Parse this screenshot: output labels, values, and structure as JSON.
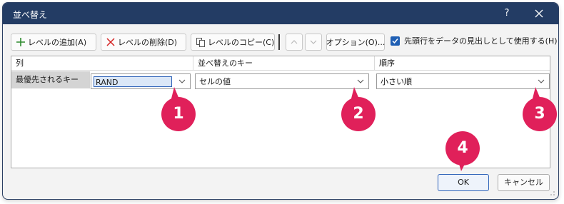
{
  "window": {
    "title": "並べ替え",
    "help_label": "?"
  },
  "toolbar": {
    "add_level": "レベルの追加(A)",
    "delete_level": "レベルの削除(D)",
    "copy_level": "レベルのコピー(C)",
    "options": "オプション(O)...",
    "header_checkbox_label": "先頭行をデータの見出しとして使用する(H)",
    "header_checkbox_checked": true
  },
  "grid": {
    "headers": [
      "列",
      "並べ替えのキー",
      "順序"
    ],
    "row": {
      "label": "最優先されるキー",
      "column": "RAND",
      "sort_on": "セルの値",
      "order": "小さい順"
    }
  },
  "callouts": [
    "1",
    "2",
    "3",
    "4"
  ],
  "buttons": {
    "ok": "OK",
    "cancel": "キャンセル"
  },
  "colors": {
    "titlebar": "#233c64",
    "callout": "#e0205a",
    "accent": "#1f5fb4"
  }
}
